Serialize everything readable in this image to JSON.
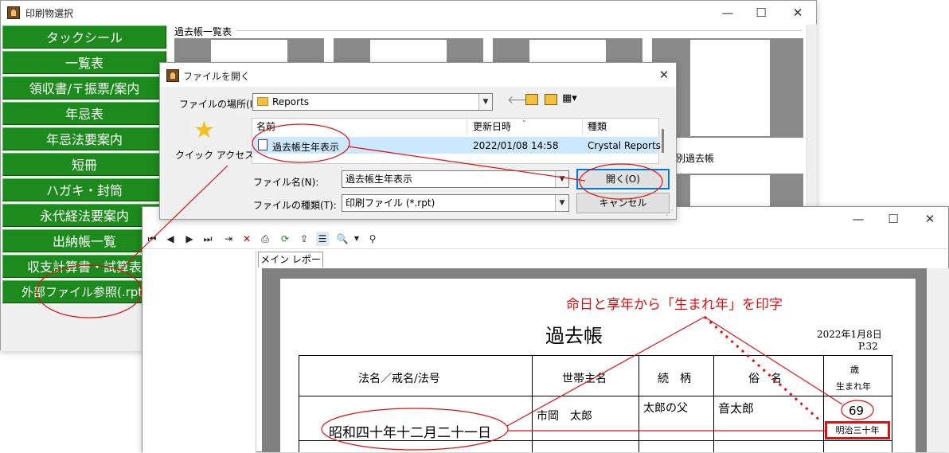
{
  "main_window": {
    "title": "印刷物選択",
    "section_label": "過去帳一覧表",
    "controls": {
      "minimize": "—",
      "maximize": "☐",
      "close": "✕"
    },
    "menu": [
      "タックシール",
      "一覧表",
      "領収書/〒振票/案内",
      "年忌表",
      "年忌法要案内",
      "短冊",
      "ハガキ・封筒",
      "永代経法要案内",
      "出納帳一覧",
      "収支計算書・試算表",
      "外部ファイル参照(.rpt)"
    ],
    "thumb_caption": "別過去帳"
  },
  "open_dialog": {
    "title": "ファイルを開く",
    "close": "✕",
    "location_label": "ファイルの場所(I):",
    "location_value": "Reports",
    "quick_access_label": "クイック アクセス",
    "columns": {
      "name": "名前",
      "modified": "更新日時",
      "type": "種類"
    },
    "files": [
      {
        "name": "過去帳生年表示",
        "modified": "2022/01/08 14:58",
        "type": "Crystal Reports"
      }
    ],
    "filename_label": "ファイル名(N):",
    "filename_value": "過去帳生年表示",
    "filetype_label": "ファイルの種類(T):",
    "filetype_value": "印刷ファイル (*.rpt)",
    "open_button": "開く(O)",
    "cancel_button": "キャンセル"
  },
  "report_window": {
    "controls": {
      "minimize": "—",
      "maximize": "☐",
      "close": "✕"
    },
    "tab_label": "メイン レポート",
    "page": {
      "title": "過去帳",
      "date": "2022年1月8日",
      "page_no": "P.32",
      "headers": {
        "name": "法名／戒名/法号",
        "householder": "世帯主名",
        "relation": "続　柄",
        "lay_name": "俗　名",
        "age": "歳",
        "birth_year": "生まれ年"
      },
      "row": {
        "death_date": "昭和四十年十二月二十一日",
        "householder": "市岡　太郎",
        "relation": "太郎の父",
        "lay_name": "音太郎",
        "age": "69",
        "birth_year": "明治三十年"
      }
    }
  },
  "annotation": {
    "text": "命日と享年から「生まれ年」を印字",
    "color": "#e01010"
  }
}
